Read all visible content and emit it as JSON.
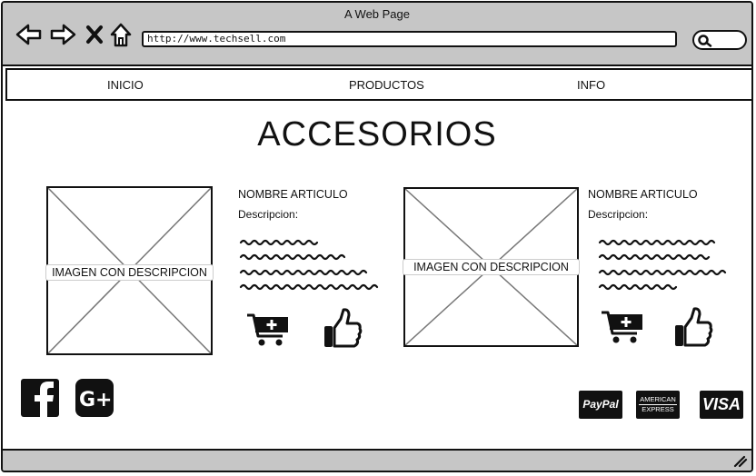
{
  "window": {
    "title": "A Web Page",
    "url": "http://www.techsell.com"
  },
  "menu": {
    "items": [
      {
        "label": "INICIO"
      },
      {
        "label": "PRODUCTOS"
      },
      {
        "label": "INFO"
      }
    ]
  },
  "page": {
    "title": "ACCESORIOS"
  },
  "products": [
    {
      "image_label": "IMAGEN CON DESCRIPCION",
      "name": "NOMBRE ARTICULO",
      "description_label": "Descripcion:"
    },
    {
      "image_label": "IMAGEN CON DESCRIPCION",
      "name": "NOMBRE ARTICULO",
      "description_label": "Descripcion:"
    }
  ],
  "social": [
    "facebook-icon",
    "google-plus-icon"
  ],
  "payments": {
    "paypal": "PayPal",
    "amex_line1": "AMERICAN",
    "amex_line2": "EXPRESS",
    "visa": "VISA"
  }
}
